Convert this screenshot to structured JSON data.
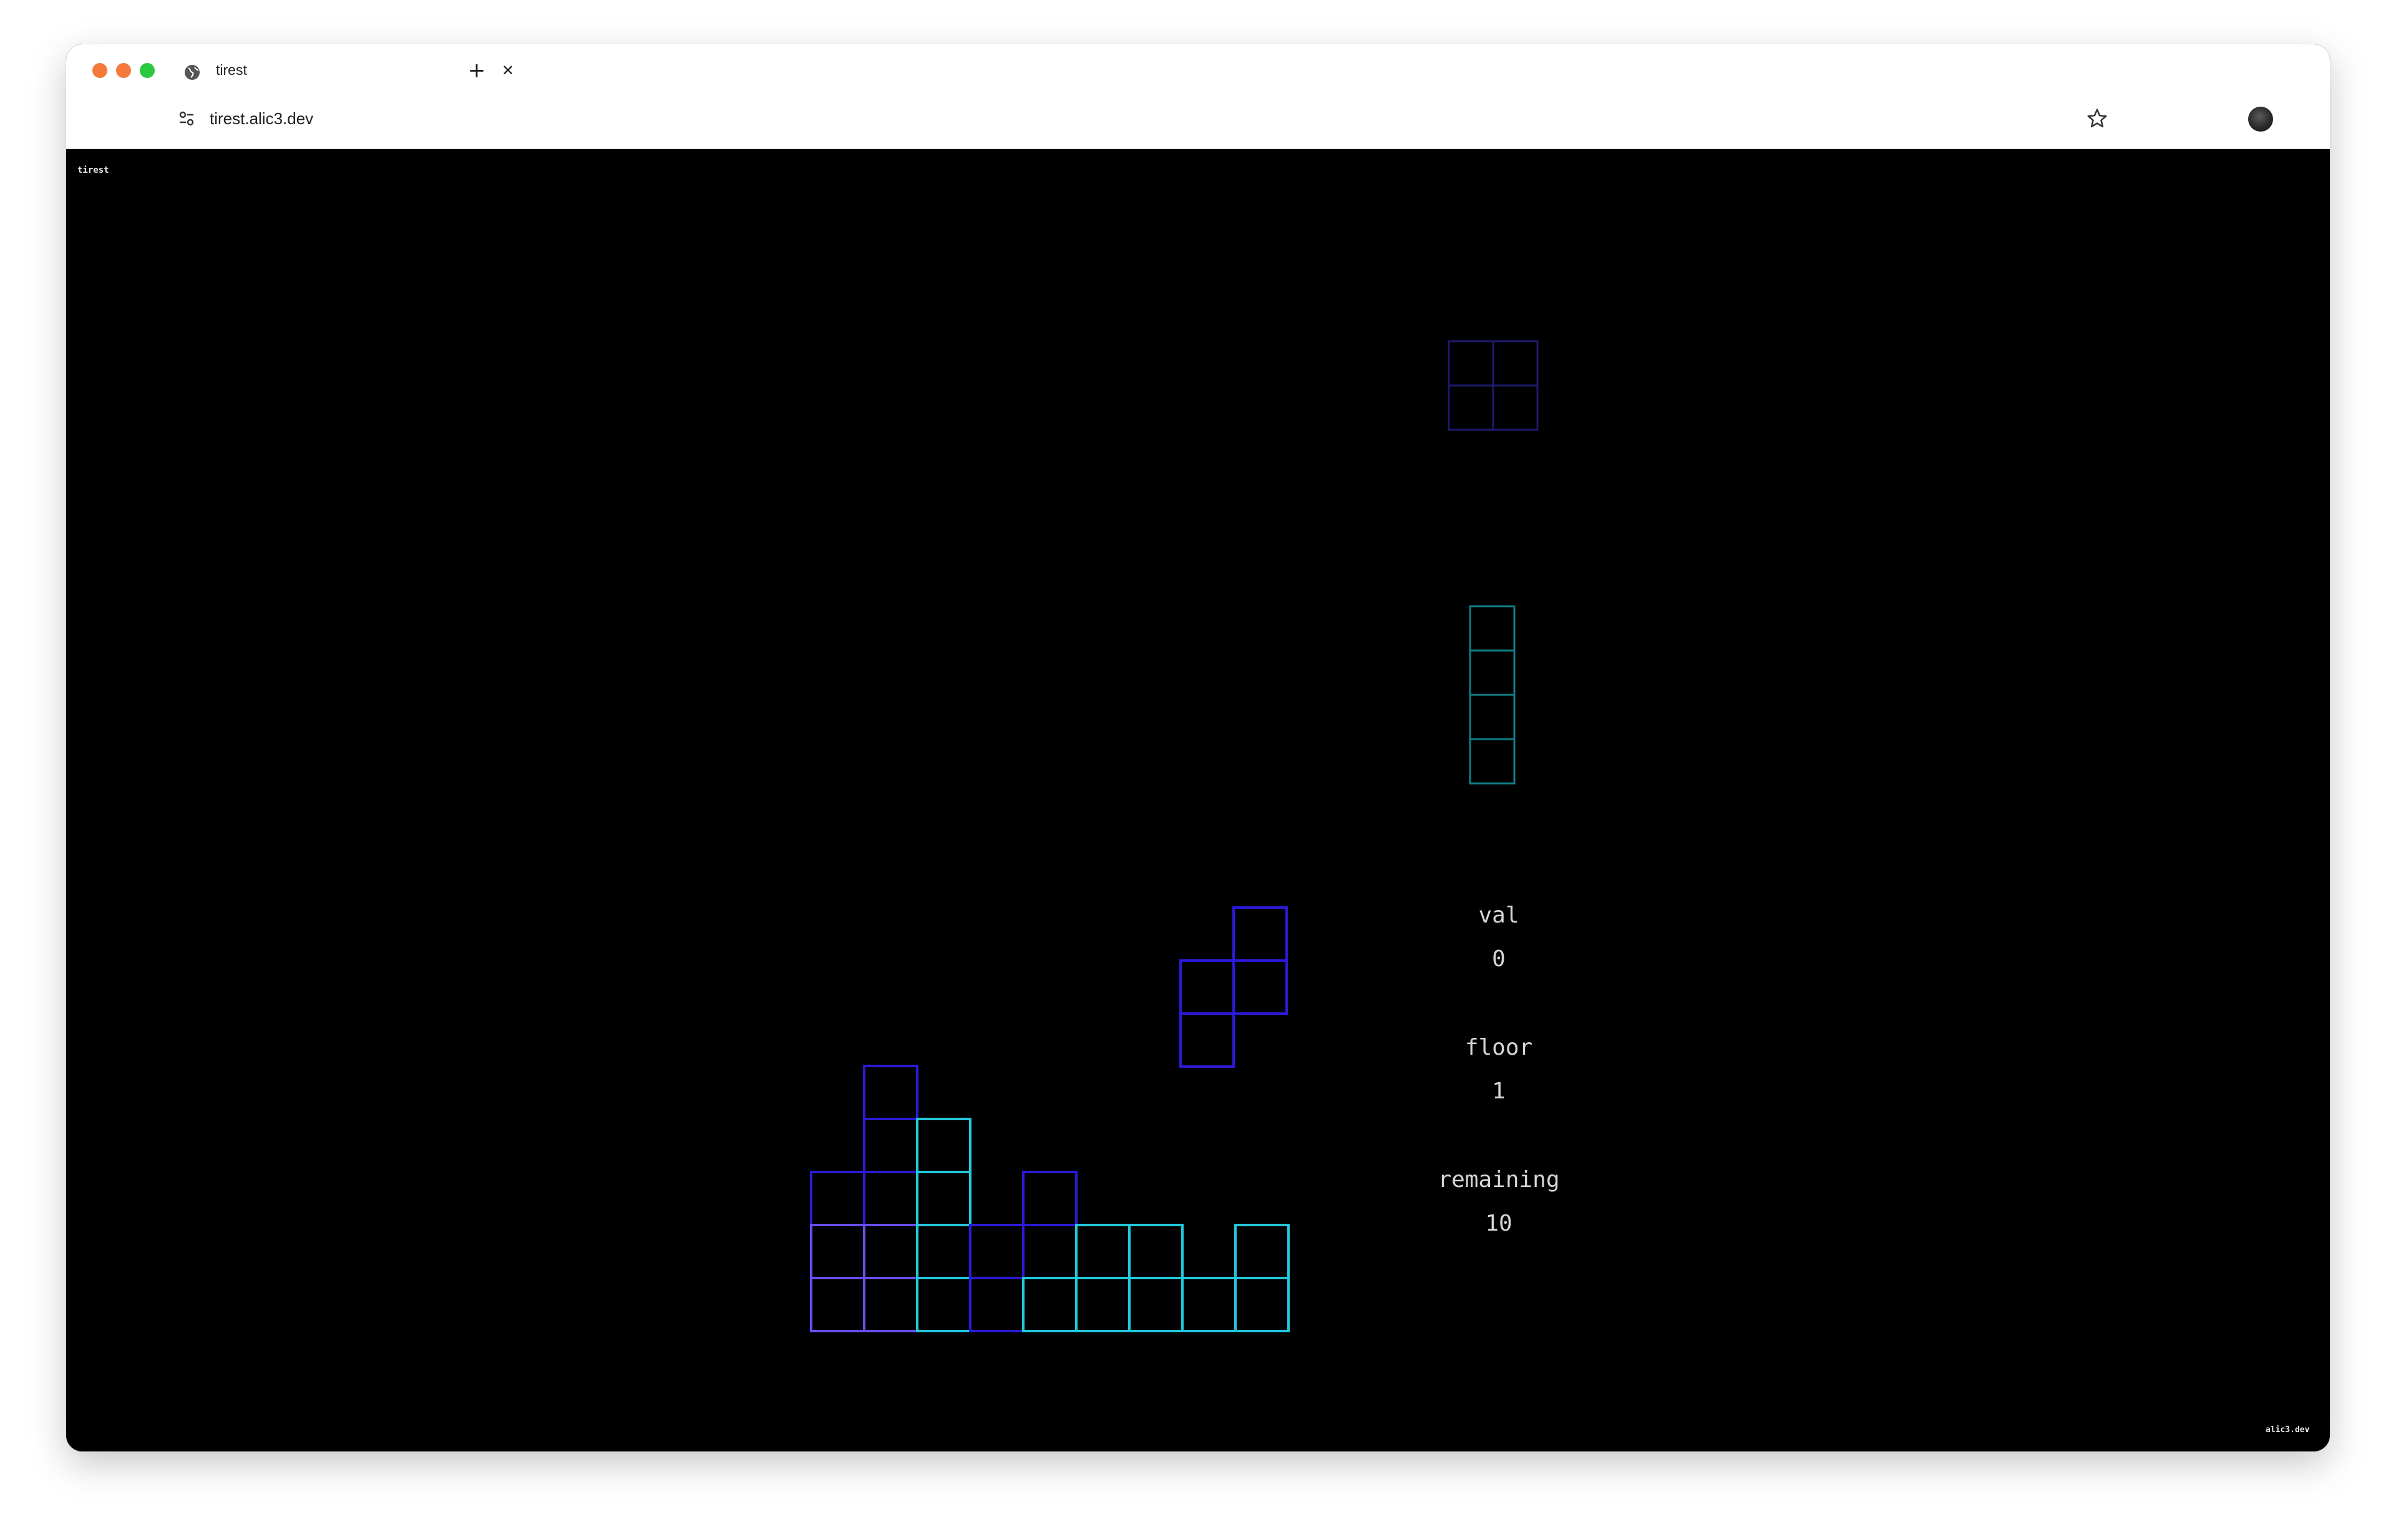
{
  "browser": {
    "tab_title": "tirest",
    "url": "tirest.alic3.dev",
    "traffic_colors": [
      "#f5793b",
      "#f5793b",
      "#2ac940"
    ]
  },
  "page": {
    "top_left_label": "tirest",
    "bottom_right_label": "alic3.dev"
  },
  "stats": [
    {
      "label": "val",
      "value": "0"
    },
    {
      "label": "floor",
      "value": "1"
    },
    {
      "label": "remaining",
      "value": "10"
    }
  ],
  "colors": {
    "dark_blue": "#2b1ad6",
    "violet": "#6a4ef0",
    "cyan": "#22c8dc",
    "teal_dim": "#0f7f86",
    "preview_dim": "#1e1a6e"
  },
  "game": {
    "preview_1": {
      "shape": "O",
      "color": "#1e1a6e"
    },
    "preview_2": {
      "shape": "I",
      "color": "#0f7f86"
    },
    "falling_piece": {
      "shape": "S",
      "color": "#2b1ad6"
    },
    "board": [
      {
        "col": 1,
        "row": 0,
        "color": "#2b1ad6"
      },
      {
        "col": 1,
        "row": 1,
        "color": "#2b1ad6"
      },
      {
        "col": 2,
        "row": 1,
        "color": "#22c8dc"
      },
      {
        "col": 0,
        "row": 2,
        "color": "#2b1ad6"
      },
      {
        "col": 1,
        "row": 2,
        "color": "#2b1ad6"
      },
      {
        "col": 2,
        "row": 2,
        "color": "#22c8dc"
      },
      {
        "col": 4,
        "row": 2,
        "color": "#2b1ad6"
      },
      {
        "col": 0,
        "row": 3,
        "color": "#6a4ef0"
      },
      {
        "col": 1,
        "row": 3,
        "color": "#6a4ef0"
      },
      {
        "col": 2,
        "row": 3,
        "color": "#22c8dc"
      },
      {
        "col": 3,
        "row": 3,
        "color": "#2b1ad6"
      },
      {
        "col": 4,
        "row": 3,
        "color": "#2b1ad6"
      },
      {
        "col": 5,
        "row": 3,
        "color": "#22c8dc"
      },
      {
        "col": 6,
        "row": 3,
        "color": "#22c8dc"
      },
      {
        "col": 8,
        "row": 3,
        "color": "#22c8dc"
      },
      {
        "col": 0,
        "row": 4,
        "color": "#6a4ef0"
      },
      {
        "col": 1,
        "row": 4,
        "color": "#6a4ef0"
      },
      {
        "col": 2,
        "row": 4,
        "color": "#22c8dc"
      },
      {
        "col": 3,
        "row": 4,
        "color": "#2b1ad6"
      },
      {
        "col": 4,
        "row": 4,
        "color": "#22c8dc"
      },
      {
        "col": 5,
        "row": 4,
        "color": "#22c8dc"
      },
      {
        "col": 6,
        "row": 4,
        "color": "#22c8dc"
      },
      {
        "col": 7,
        "row": 4,
        "color": "#22c8dc"
      },
      {
        "col": 8,
        "row": 4,
        "color": "#22c8dc"
      }
    ]
  }
}
